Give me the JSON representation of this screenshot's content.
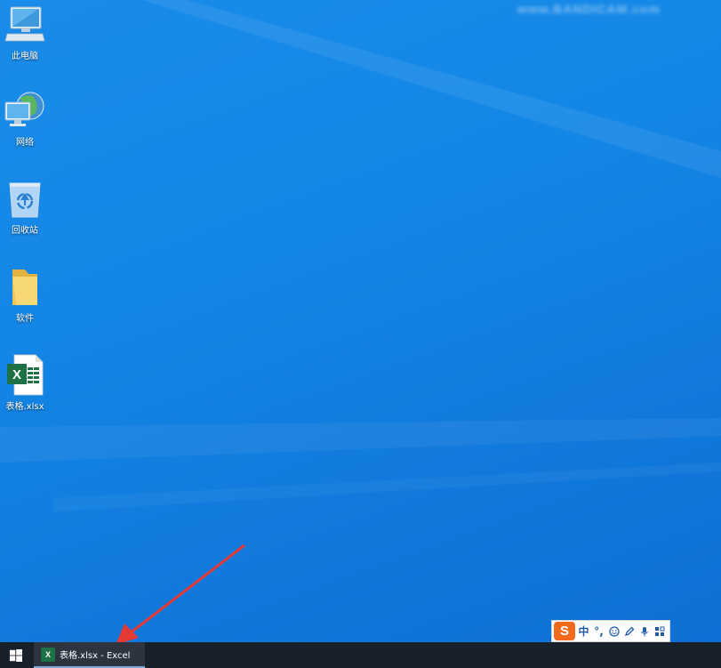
{
  "watermark": "www.BANDICAM.com",
  "desktop": {
    "icons": [
      {
        "label": "此电脑",
        "icon": "computer-icon"
      },
      {
        "label": "网络",
        "icon": "network-icon"
      },
      {
        "label": "回收站",
        "icon": "recycle-bin-icon"
      },
      {
        "label": "软件",
        "icon": "folder-icon"
      },
      {
        "label": "表格.xlsx",
        "icon": "excel-file-icon"
      }
    ]
  },
  "ime": {
    "logo": "S",
    "mode": "中",
    "punct": "°,",
    "buttons": [
      "emoji-icon",
      "pen-icon",
      "microphone-icon",
      "grid-icon"
    ]
  },
  "taskbar": {
    "app_icon_letter": "X",
    "active_app": "表格.xlsx - Excel"
  },
  "colors": {
    "desktop": "#1487e6",
    "taskbar": "#18202b",
    "excel_green": "#1e7145",
    "arrow": "#e53935",
    "sogou_orange": "#f26b1d"
  }
}
